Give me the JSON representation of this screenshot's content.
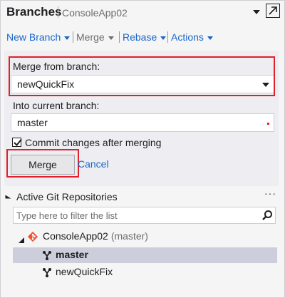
{
  "header": {
    "title": "Branches",
    "subtitle": "ConsoleApp02"
  },
  "actions": {
    "new_branch": "New Branch",
    "merge": "Merge",
    "rebase": "Rebase",
    "actions": "Actions"
  },
  "merge_panel": {
    "from_label": "Merge from branch:",
    "from_value": "newQuickFix",
    "into_label": "Into current branch:",
    "into_value": "master",
    "commit_label": "Commit changes after merging",
    "commit_checked": true,
    "merge_button": "Merge",
    "cancel_link": "Cancel"
  },
  "repos": {
    "title": "Active Git Repositories",
    "more": "···",
    "filter_placeholder": "Type here to filter the list",
    "repo_name": "ConsoleApp02",
    "repo_branch": "(master)",
    "branches": [
      "master",
      "newQuickFix"
    ],
    "selected_branch": "master"
  },
  "colors": {
    "accent": "#1a66c9",
    "highlight_box": "#e0202a",
    "selected_row": "#cccedb",
    "git_icon": "#f05033"
  }
}
